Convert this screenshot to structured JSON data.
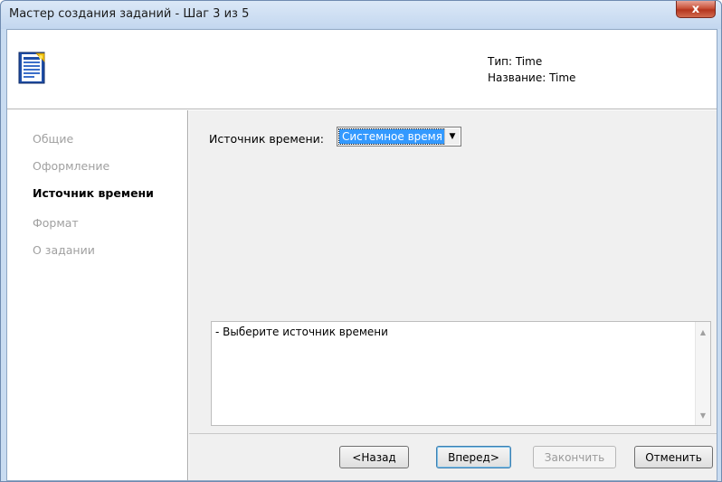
{
  "window": {
    "title": "Мастер создания заданий - Шаг 3 из 5",
    "close_label": "x"
  },
  "header": {
    "type_text": "Тип: Time",
    "name_text": "Название: Time"
  },
  "sidebar": {
    "items": [
      {
        "label": "Общие",
        "active": false
      },
      {
        "label": "Оформление",
        "active": false
      },
      {
        "label": "Источник времени",
        "active": true
      },
      {
        "label": "Формат",
        "active": false
      },
      {
        "label": "О задании",
        "active": false
      }
    ]
  },
  "main": {
    "source_label": "Источник времени:",
    "source_value": "Системное время",
    "description": "- Выберите источник времени"
  },
  "buttons": {
    "back": "<Назад",
    "next": "Вперед>",
    "finish": "Закончить",
    "cancel": "Отменить"
  },
  "icons": {
    "app_icon": "wizard-document-icon",
    "dropdown_icon": "chevron-down-icon",
    "scroll_up_icon": "scroll-up-icon",
    "scroll_down_icon": "scroll-down-icon"
  },
  "colors": {
    "selection": "#3399ff",
    "close_button": "#c9533a",
    "title_bar": "#c3d7ef"
  }
}
